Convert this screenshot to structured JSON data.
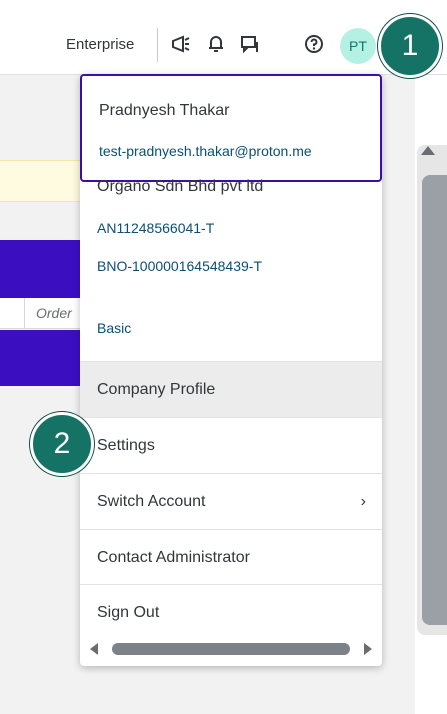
{
  "header": {
    "enterprise_label": "Enterprise",
    "avatar_initials": "PT",
    "icons": [
      "megaphone-icon",
      "bell-icon",
      "chat-icon",
      "help-icon"
    ]
  },
  "background": {
    "order_label": "Order"
  },
  "menu": {
    "user": {
      "name": "Pradnyesh Thakar",
      "email": "test-pradnyesh.thakar@proton.me"
    },
    "org": {
      "name": "Organo Sdn Bhd pvt ltd",
      "an_id": "AN11248566041-T",
      "bno_id": "BNO-100000164548439-T",
      "plan": "Basic"
    },
    "items": [
      {
        "label": "Company Profile"
      },
      {
        "label": "Settings"
      },
      {
        "label": "Switch Account",
        "chevron": "›"
      },
      {
        "label": "Contact Administrator"
      },
      {
        "label": "Sign Out"
      }
    ]
  },
  "callouts": {
    "one": "1",
    "two": "2"
  },
  "colors": {
    "accent_purple": "#3b0fa6",
    "avatar_bg": "#b5f1e3",
    "callout_bg": "#157366",
    "link_text": "#0b4f74"
  }
}
